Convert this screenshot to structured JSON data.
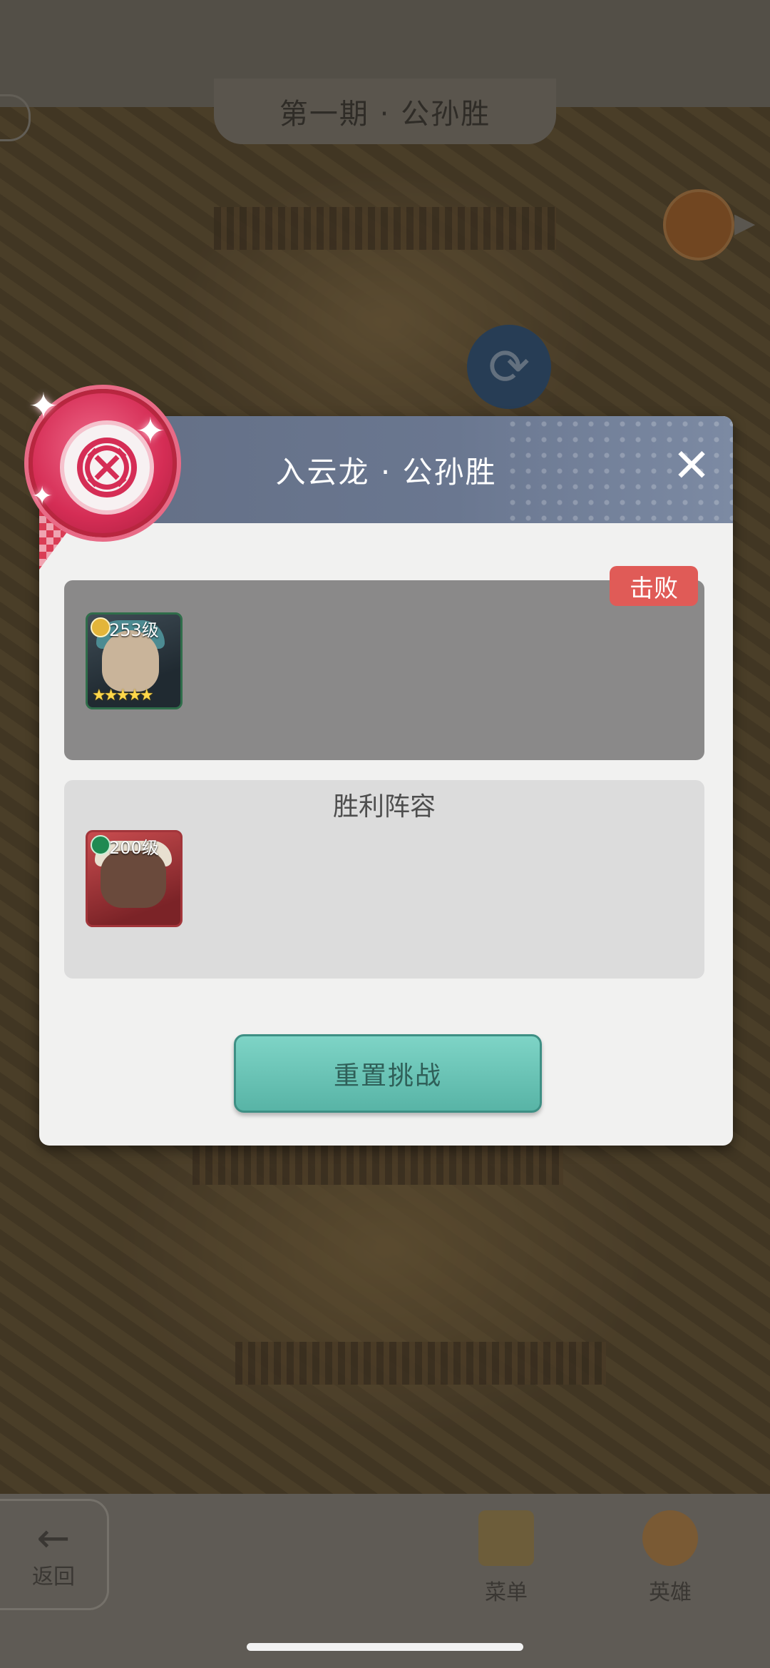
{
  "map": {
    "stage_title": "第一期 · 公孙胜"
  },
  "dialog": {
    "title": "入云龙 · 公孙胜",
    "defeat_label": "击败",
    "enemy_hero": {
      "level": "253级",
      "stars": 5,
      "portrait": "grey-haired-warrior-portrait"
    },
    "victory_section_title": "胜利阵容",
    "ally_hero": {
      "level": "200级",
      "portrait": "beast-warrior-portrait"
    },
    "reset_button": "重置挑战",
    "close_icon": "close-icon"
  },
  "bottom_bar": {
    "back_label": "返回",
    "menu_label": "菜单",
    "heroes_label": "英雄"
  },
  "colors": {
    "header": "#6a7790",
    "defeat_tag": "#e05b57",
    "reset_button": "#6cc4b6",
    "badge": "#d52d55"
  }
}
